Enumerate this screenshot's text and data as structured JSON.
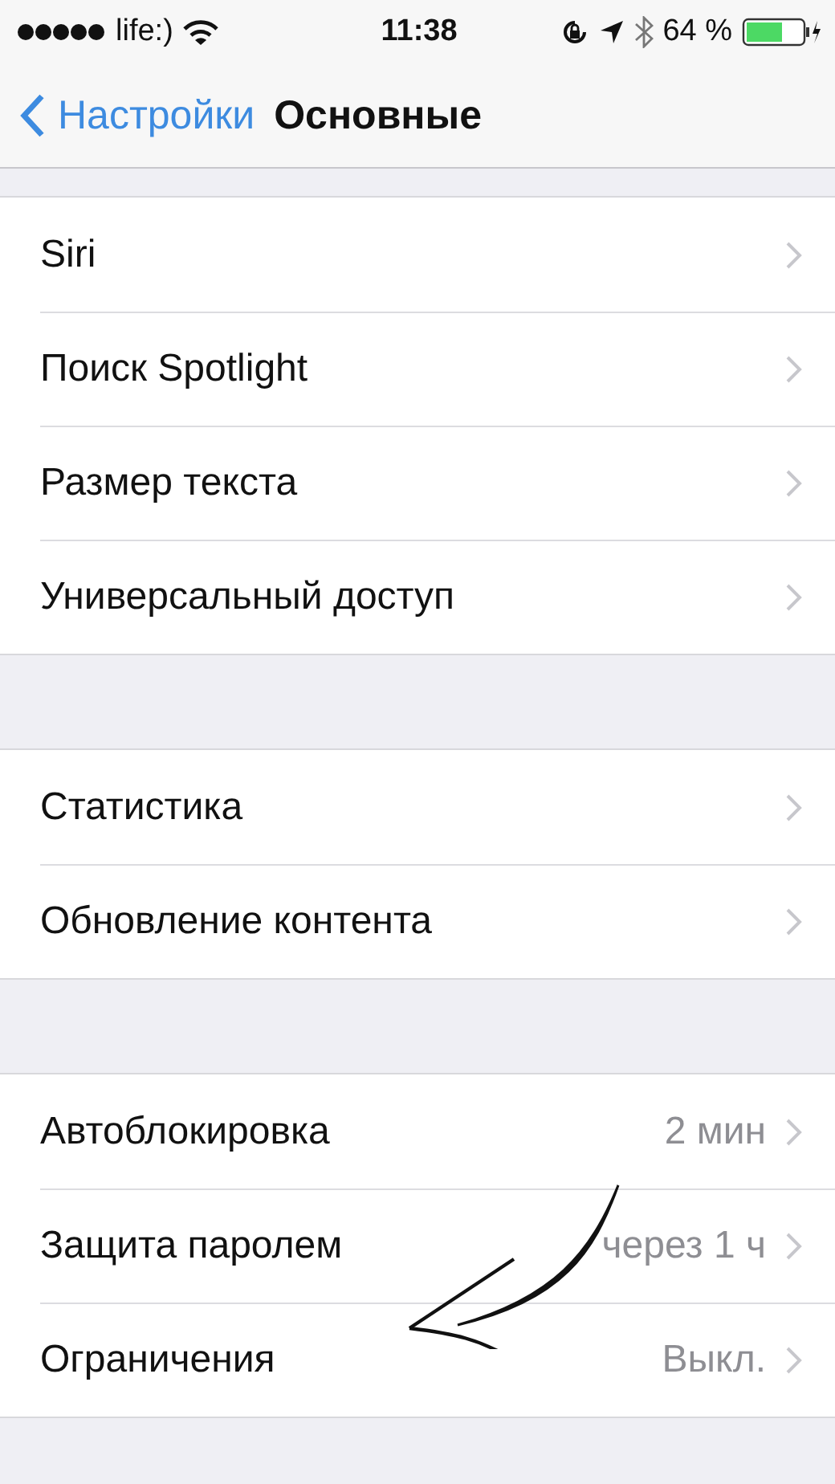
{
  "status_bar": {
    "carrier": "life:)",
    "time": "11:38",
    "battery": "64 %"
  },
  "nav_bar": {
    "back": "Настройки",
    "title": "Основные"
  },
  "groups": [
    {
      "items": [
        {
          "label": "Siri"
        },
        {
          "label": "Поиск Spotlight"
        },
        {
          "label": "Размер текста"
        },
        {
          "label": "Универсальный доступ"
        }
      ]
    },
    {
      "items": [
        {
          "label": "Статистика"
        },
        {
          "label": "Обновление контента"
        }
      ]
    },
    {
      "items": [
        {
          "label": "Автоблокировка",
          "value": "2 мин"
        },
        {
          "label": "Защита паролем",
          "value": "через 1 ч"
        },
        {
          "label": "Ограничения",
          "value": "Выкл."
        }
      ]
    }
  ],
  "annotation": {
    "kind": "arrow"
  }
}
